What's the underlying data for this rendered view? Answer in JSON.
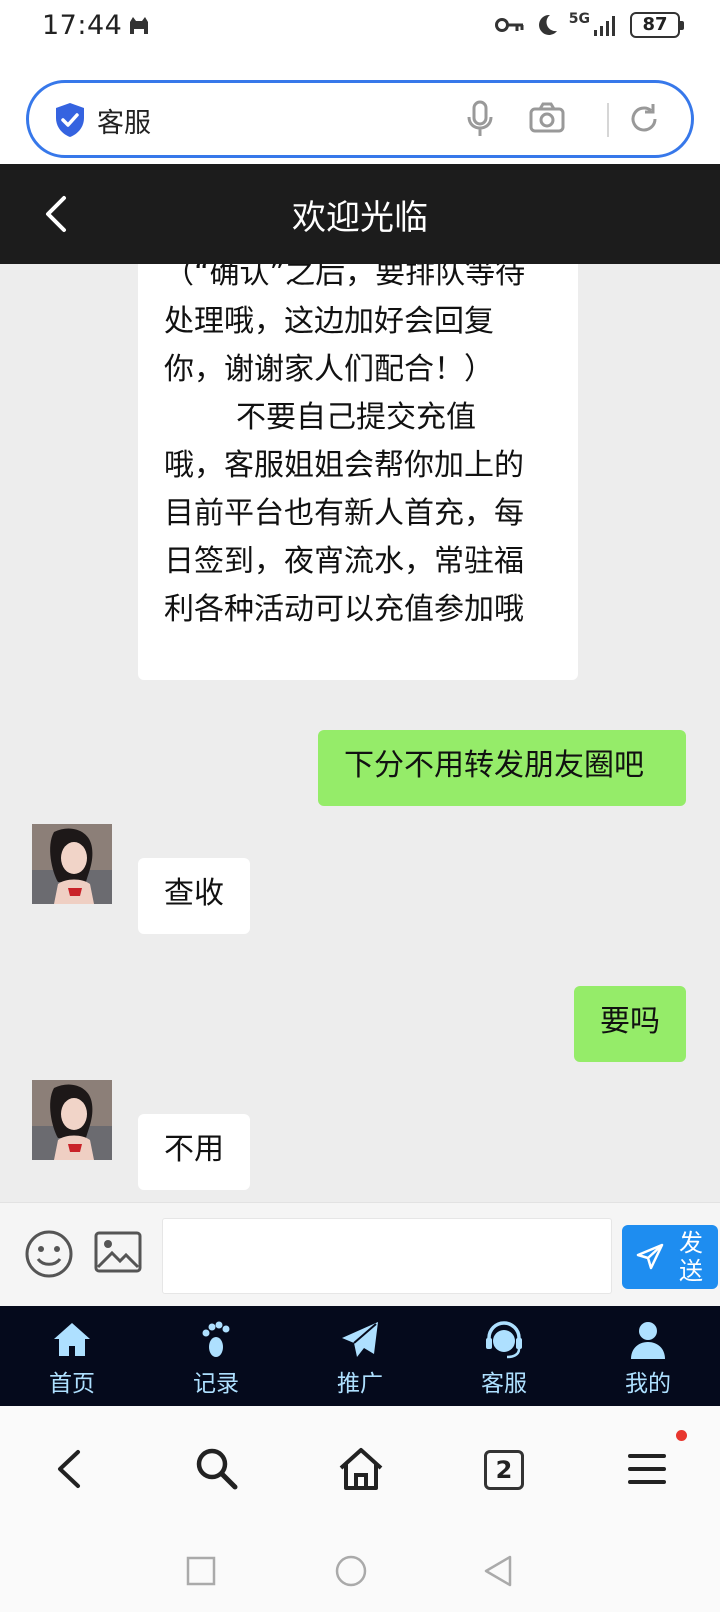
{
  "status_bar": {
    "time": "17:44",
    "network": "5G",
    "battery": "87"
  },
  "browser": {
    "url_text": "客服",
    "tab_count": "2"
  },
  "header": {
    "title": "欢迎光临"
  },
  "chat": {
    "long_message_lines": [
      "（“确认”之后，要排队等待",
      "处理哦，这边加好会回复",
      "你，谢谢家人们配合！）",
      "不要自己提交充值",
      "哦，客服姐姐会帮你加上的",
      "目前平台也有新人首充，每",
      "日签到，夜宵流水，常驻福",
      "利各种活动可以充值参加哦"
    ],
    "msg_1": "下分不用转发朋友圈吧",
    "msg_2": "查收",
    "msg_3": "要吗",
    "msg_4": "不用"
  },
  "input": {
    "placeholder": "",
    "send_label": "发送"
  },
  "nav": {
    "home": "首页",
    "records": "记录",
    "promote": "推广",
    "service": "客服",
    "mine": "我的"
  },
  "colors": {
    "accent": "#1e8df0",
    "mine_bubble": "#95ec69",
    "nav_bg": "#050a1c",
    "nav_text": "#aee0ff",
    "url_border": "#3778ea"
  }
}
